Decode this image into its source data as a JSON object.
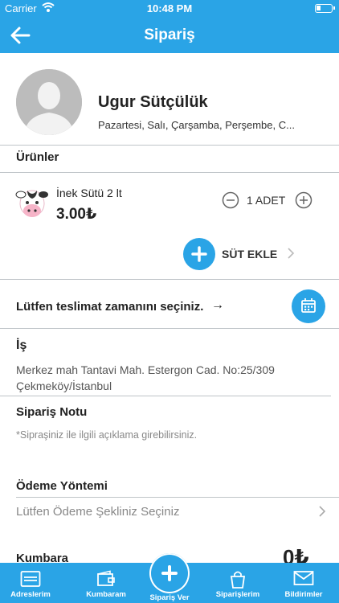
{
  "status_bar": {
    "carrier": "Carrier",
    "time": "10:48 PM"
  },
  "nav": {
    "title": "Sipariş"
  },
  "profile": {
    "name": "Ugur Sütçülük",
    "days": "Pazartesi, Salı, Çarşamba, Perşembe, C..."
  },
  "products": {
    "section_label": "Ürünler",
    "item": {
      "name": "İnek Sütü 2 lt",
      "price": "3.00₺",
      "quantity": "1 ADET"
    },
    "add_label": "SÜT EKLE"
  },
  "delivery": {
    "label": "Lütfen teslimat zamanını seçiniz.",
    "arrow": "→"
  },
  "address": {
    "title": "İş",
    "line1": "Merkez mah Tantavi Mah. Estergon Cad. No:25/309",
    "line2": "Çekmeköy/İstanbul"
  },
  "note": {
    "label": "Sipariş Notu",
    "hint": "*Sipraşiniz ile ilgili açıklama girebilirsiniz."
  },
  "payment": {
    "label": "Ödeme Yöntemi",
    "select": "Lütfen Ödeme Şekliniz Seçiniz"
  },
  "kumbara": {
    "label": "Kumbara",
    "value": "0₺"
  },
  "tabs": [
    {
      "label": "Adreslerim",
      "icon": "address-card-icon"
    },
    {
      "label": "Kumbaram",
      "icon": "wallet-icon"
    },
    {
      "label": "Sipariş Ver",
      "icon": "plus-icon"
    },
    {
      "label": "Siparişlerim",
      "icon": "shopping-bag-icon"
    },
    {
      "label": "Bildirimler",
      "icon": "mail-icon"
    }
  ],
  "colors": {
    "primary": "#2aa4e6"
  }
}
